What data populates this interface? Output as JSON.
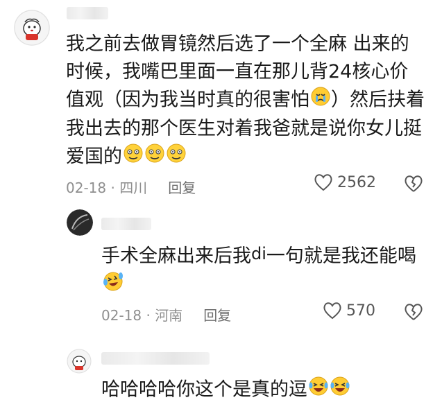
{
  "comments": [
    {
      "text": "我之前去做胃镜然后选了一个全麻 出来的时候，我嘴巴里面一直在那儿背24核心价值观（因为我当时真的很害怕",
      "text_after_cry": "）然后扶着我出去的那个医生对着我爸就是说你女儿挺爱国的",
      "date_location": "02-18 · 四川",
      "reply_label": "回复",
      "likes": "2562"
    },
    {
      "text_before": "手术全麻出来后我",
      "text_di": "di",
      "text_after": "一句就是我还能喝",
      "date_location": "02-18 · 河南",
      "reply_label": "回复",
      "likes": "570"
    },
    {
      "text": "哈哈哈哈你这个是真的逗"
    }
  ]
}
